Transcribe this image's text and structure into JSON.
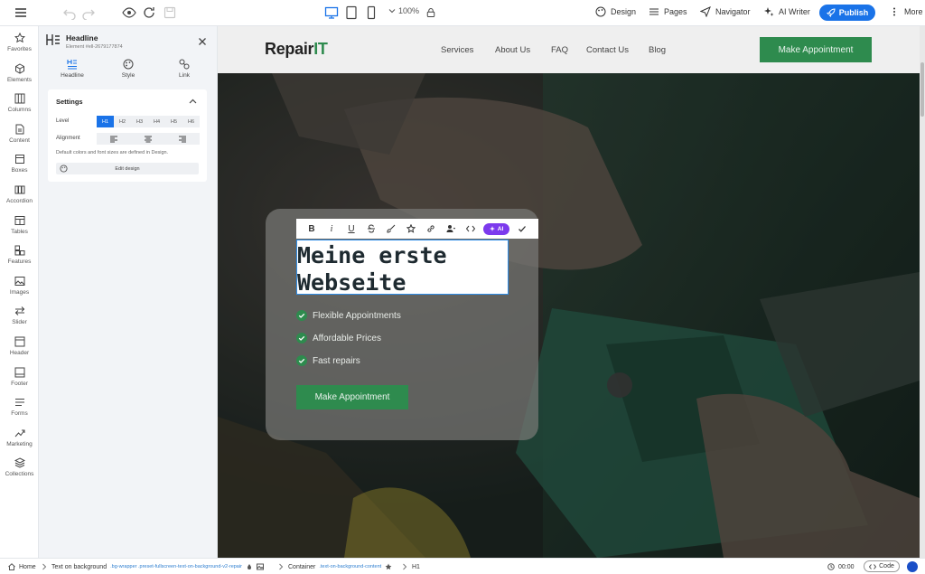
{
  "topbar": {
    "zoom": "100%",
    "design_label": "Design",
    "pages_label": "Pages",
    "navigator_label": "Navigator",
    "ai_writer_label": "AI Writer",
    "publish_label": "Publish",
    "more_label": "More"
  },
  "sidebar": {
    "items": [
      {
        "label": "Favorites",
        "icon": "star-icon"
      },
      {
        "label": "Elements",
        "icon": "cube-icon"
      },
      {
        "label": "Columns",
        "icon": "columns-icon"
      },
      {
        "label": "Content",
        "icon": "document-icon"
      },
      {
        "label": "Boxes",
        "icon": "box-icon"
      },
      {
        "label": "Accordion",
        "icon": "accordion-icon"
      },
      {
        "label": "Tables",
        "icon": "table-icon"
      },
      {
        "label": "Features",
        "icon": "features-icon"
      },
      {
        "label": "Images",
        "icon": "image-icon"
      },
      {
        "label": "Slider",
        "icon": "slider-icon"
      },
      {
        "label": "Header",
        "icon": "header-icon"
      },
      {
        "label": "Footer",
        "icon": "footer-icon"
      },
      {
        "label": "Forms",
        "icon": "forms-icon"
      },
      {
        "label": "Marketing",
        "icon": "chart-line-icon"
      },
      {
        "label": "Collections",
        "icon": "layers-icon"
      }
    ]
  },
  "panel": {
    "title": "Headline",
    "element_id": "Element #ell-2679177874",
    "tabs": [
      {
        "label": "Headline"
      },
      {
        "label": "Style"
      },
      {
        "label": "Link"
      }
    ],
    "settings_title": "Settings",
    "level_label": "Level",
    "levels": [
      "H1",
      "H2",
      "H3",
      "H4",
      "H5",
      "H6"
    ],
    "alignment_label": "Alignment",
    "hint": "Default colors and font sizes are defined in Design.",
    "edit_design_label": "Edit design"
  },
  "site": {
    "logo_main": "Repair",
    "logo_accent": "IT",
    "nav": [
      "Services",
      "About Us",
      "FAQ",
      "Contact Us",
      "Blog"
    ],
    "nav_cta": "Make Appointment",
    "headline_line1": "Meine erste",
    "headline_line2": "Webseite",
    "features": [
      "Flexible Appointments",
      "Affordable Prices",
      "Fast repairs"
    ],
    "card_cta": "Make Appointment",
    "ai_label": "AI",
    "accent_color": "#2e8b4e"
  },
  "statusbar": {
    "home": "Home",
    "crumb1": "Text on background",
    "crumb1_class": ".bg-wrapper .preset-fullscreen-text-on-background-v2-repair",
    "crumb2": "Container",
    "crumb2_class": ".text-on-background-content",
    "crumb3": "H1",
    "time": "00:00",
    "code_label": "Code"
  }
}
